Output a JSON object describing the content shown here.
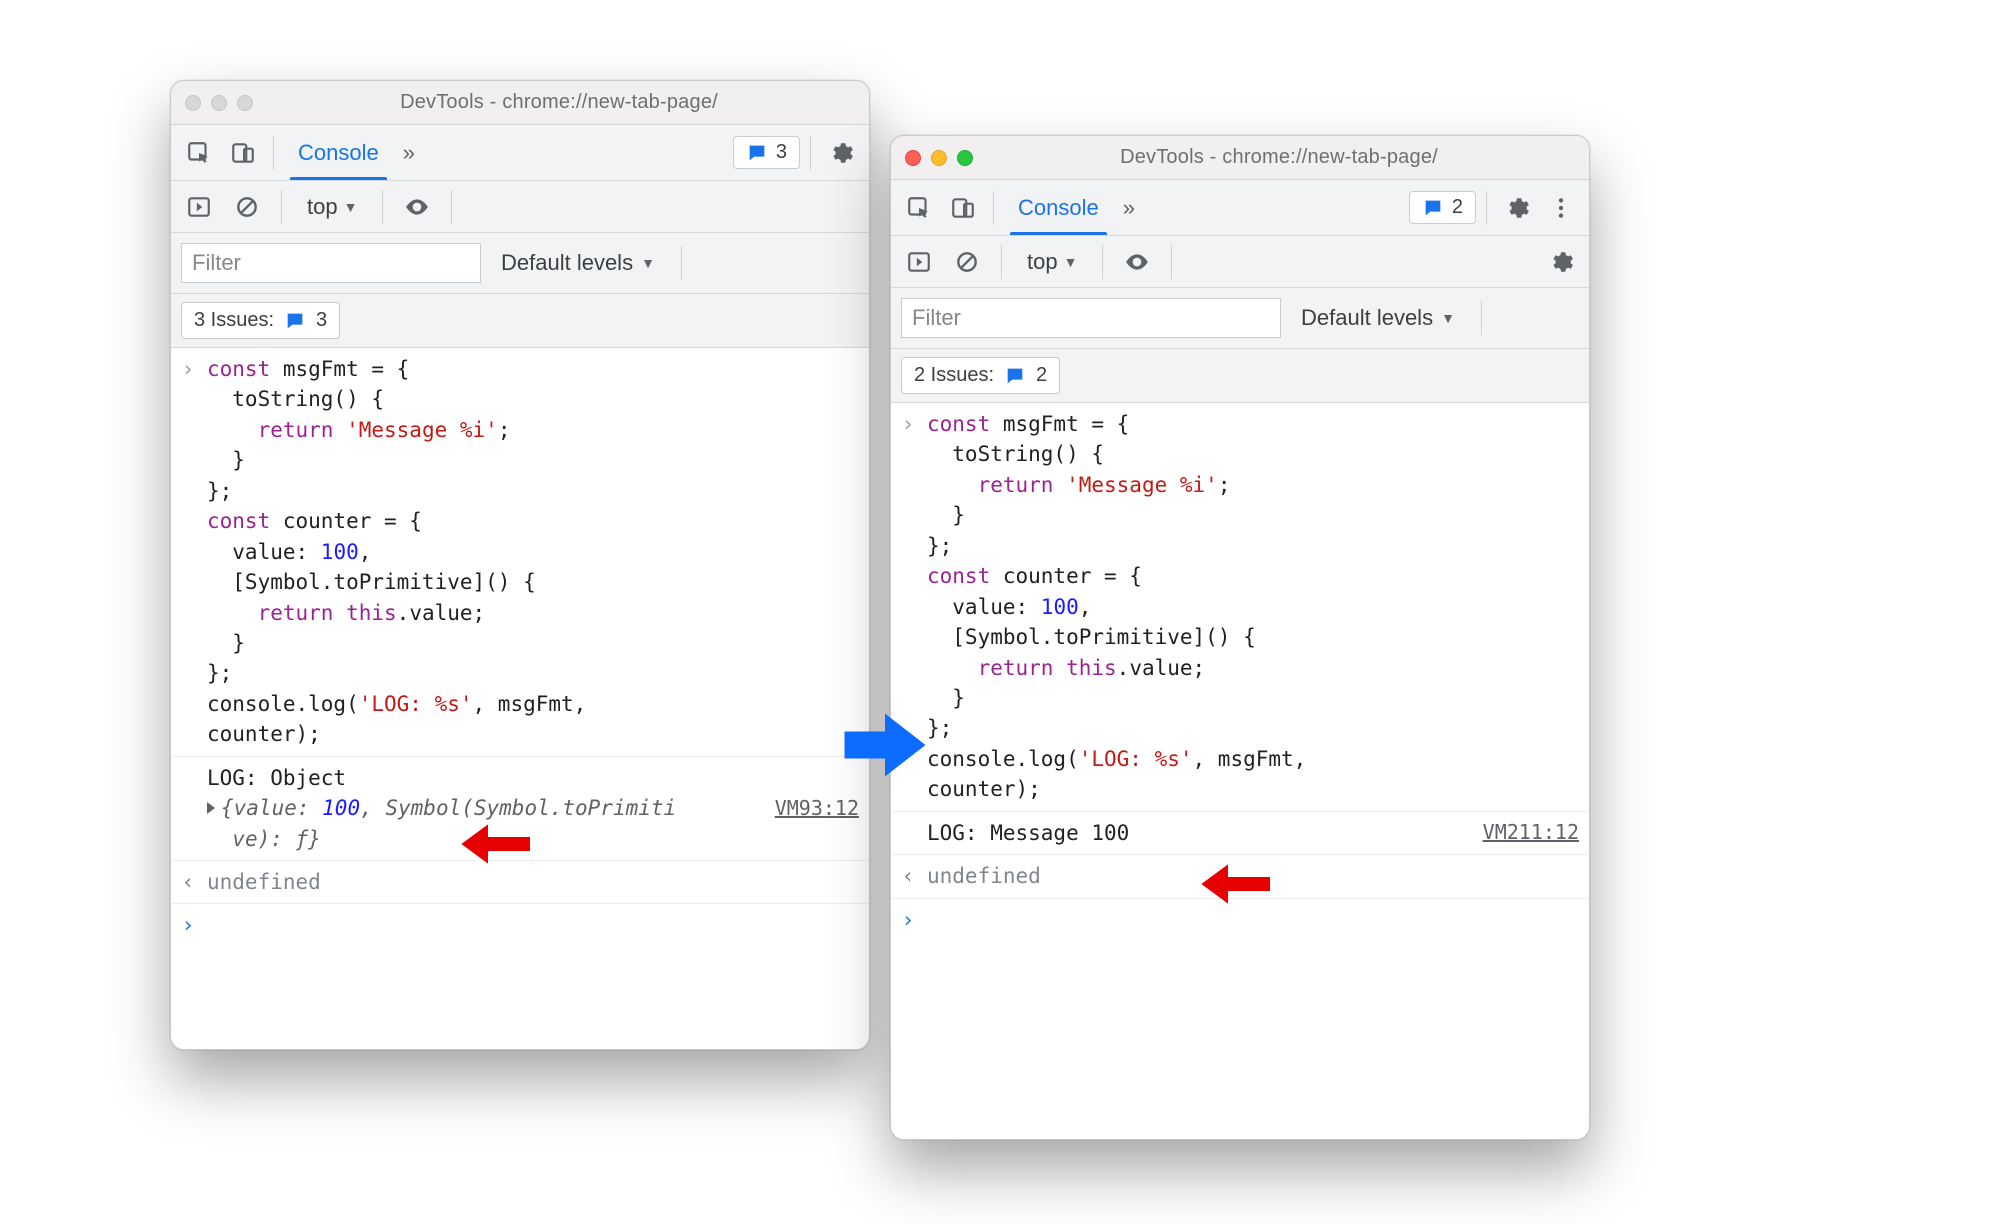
{
  "left": {
    "title": "DevTools - chrome://new-tab-page/",
    "tab": "Console",
    "issue_count": "3",
    "context": "top",
    "filter_placeholder": "Filter",
    "levels_label": "Default levels",
    "issues_label": "3 Issues:",
    "issues_n": "3",
    "log_line": "LOG: Object",
    "src": "VM93:12",
    "obj_detail_a": "{value: ",
    "obj_val": "100",
    "obj_detail_b": ", Symbol(Symbol.toPrimiti",
    "obj_detail_c": "ve): ƒ}",
    "undef": "undefined"
  },
  "right": {
    "title": "DevTools - chrome://new-tab-page/",
    "tab": "Console",
    "issue_count": "2",
    "context": "top",
    "filter_placeholder": "Filter",
    "levels_label": "Default levels",
    "issues_label": "2 Issues:",
    "issues_n": "2",
    "log_line": "LOG: Message 100",
    "src": "VM211:12",
    "undef": "undefined"
  },
  "code": {
    "l1a": "const",
    "l1b": " msgFmt = {",
    "l2": "  toString() {",
    "l3a": "    ",
    "l3b": "return",
    "l3c": " ",
    "l3d": "'Message %i'",
    "l3e": ";",
    "l4": "  }",
    "l5": "};",
    "l6a": "const",
    "l6b": " counter = {",
    "l7a": "  value: ",
    "l7b": "100",
    "l7c": ",",
    "l8": "  [Symbol.toPrimitive]() {",
    "l9a": "    ",
    "l9b": "return",
    "l9c": " ",
    "l9d": "this",
    "l9e": ".value;",
    "l10": "  }",
    "l11": "};",
    "l12a": "console.log(",
    "l12b": "'LOG: %s'",
    "l12c": ", msgFmt,",
    "l13": "counter);"
  }
}
